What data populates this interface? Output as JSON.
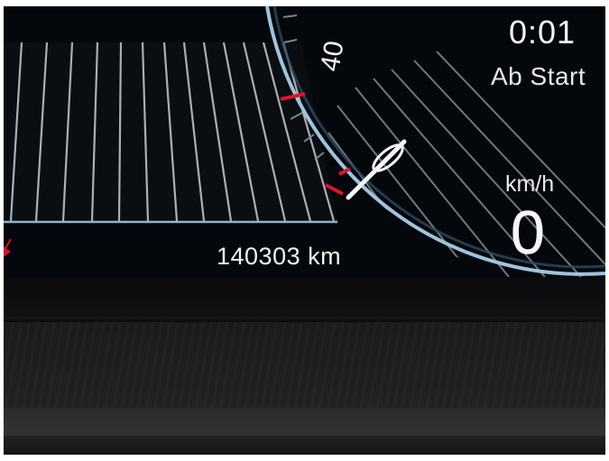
{
  "instrument_cluster": {
    "trip": {
      "time": "0:01",
      "label": "Ab Start"
    },
    "speed": {
      "unit": "km/h",
      "value": "0"
    },
    "odometer": "140303 km",
    "gauge": {
      "visible_tick_label": "40",
      "needle_value_kmh": 0
    }
  },
  "colors": {
    "background": "#04070b",
    "gauge_ring": "#9fc4dc",
    "red_marks": "#e0142a",
    "text": "#f2f4f6"
  }
}
